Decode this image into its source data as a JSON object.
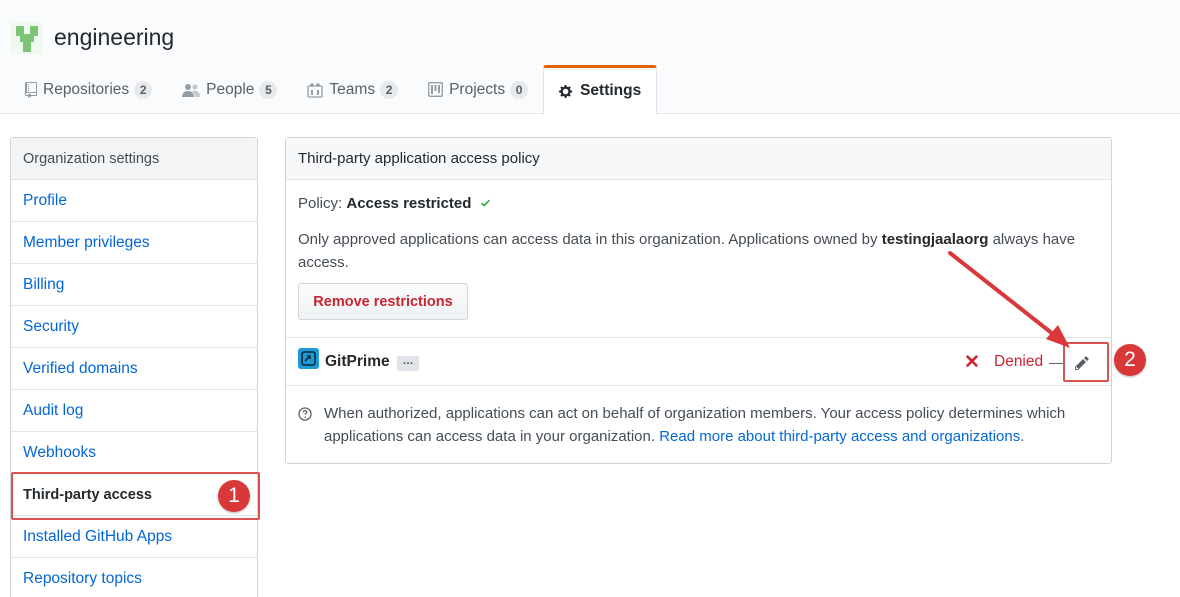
{
  "org": {
    "name": "engineering"
  },
  "tabs": [
    {
      "label": "Repositories",
      "count": "2",
      "icon": "repo-icon"
    },
    {
      "label": "People",
      "count": "5",
      "icon": "people-icon"
    },
    {
      "label": "Teams",
      "count": "2",
      "icon": "teams-icon"
    },
    {
      "label": "Projects",
      "count": "0",
      "icon": "project-icon"
    },
    {
      "label": "Settings",
      "icon": "gear-icon",
      "selected": true
    }
  ],
  "sidebar": {
    "heading": "Organization settings",
    "items": [
      {
        "label": "Profile"
      },
      {
        "label": "Member privileges"
      },
      {
        "label": "Billing"
      },
      {
        "label": "Security"
      },
      {
        "label": "Verified domains"
      },
      {
        "label": "Audit log"
      },
      {
        "label": "Webhooks"
      },
      {
        "label": "Third-party access",
        "active": true
      },
      {
        "label": "Installed GitHub Apps"
      },
      {
        "label": "Repository topics"
      }
    ]
  },
  "main": {
    "title": "Third-party application access policy",
    "policy_label": "Policy:",
    "policy_value": "Access restricted",
    "desc_before": "Only approved applications can access data in this organization. Applications owned by ",
    "desc_org": "testingjaalaorg",
    "desc_after": " always have access.",
    "remove_button": "Remove restrictions",
    "app": {
      "name": "GitPrime",
      "ellipsis": "…",
      "status": "Denied"
    },
    "help_text": "When authorized, applications can act on behalf of organization members. Your access policy determines which applications can access data in your organization. ",
    "help_link": "Read more about third-party access and organizations",
    "help_end": "."
  },
  "annotations": {
    "badge1": "1",
    "badge2": "2"
  },
  "colors": {
    "accent_tab": "#e36209",
    "link": "#0366d6",
    "danger": "#cb2431",
    "annotation": "#d9383a",
    "success": "#28a745"
  }
}
